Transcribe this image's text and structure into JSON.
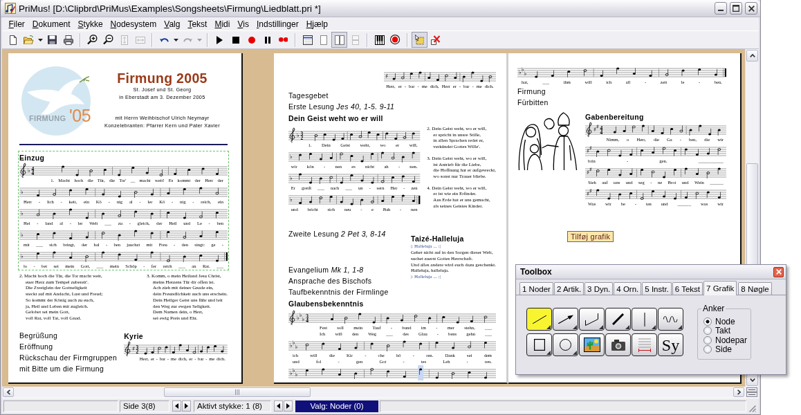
{
  "window": {
    "title": "PriMus! [D:\\Clipbrd\\PriMus\\Examples\\Songsheets\\Firmung\\Liedblatt.pri *]"
  },
  "menu": [
    "Filer",
    "Dokument",
    "Stykke",
    "Nodesystem",
    "Valg",
    "Tekst",
    "Midi",
    "Vis",
    "Indstillinger",
    "Hjælp"
  ],
  "toolbar": [
    {
      "buttons": [
        {
          "kind": "new",
          "disabled": false,
          "selected": false
        },
        {
          "kind": "open",
          "disabled": false,
          "selected": false
        },
        {
          "kind": "dropdown",
          "disabled": false,
          "selected": false
        },
        {
          "kind": "save",
          "disabled": false,
          "selected": false
        },
        {
          "kind": "print",
          "disabled": false,
          "selected": false
        }
      ]
    },
    {
      "buttons": [
        {
          "kind": "zoom-in",
          "disabled": false,
          "selected": false
        },
        {
          "kind": "zoom-out",
          "disabled": false,
          "selected": false
        },
        {
          "kind": "fit-height",
          "disabled": true,
          "selected": false
        },
        {
          "kind": "fit-width",
          "disabled": true,
          "selected": false
        }
      ]
    },
    {
      "buttons": [
        {
          "kind": "undo",
          "disabled": false,
          "selected": false
        },
        {
          "kind": "dropdown",
          "disabled": false,
          "selected": false
        },
        {
          "kind": "redo",
          "disabled": true,
          "selected": false
        },
        {
          "kind": "dropdown",
          "disabled": true,
          "selected": false
        }
      ]
    },
    {
      "buttons": [
        {
          "kind": "play",
          "disabled": false,
          "selected": false
        },
        {
          "kind": "stop",
          "disabled": false,
          "selected": false
        },
        {
          "kind": "record",
          "disabled": false,
          "selected": false
        },
        {
          "kind": "pause",
          "disabled": false,
          "selected": false
        },
        {
          "kind": "record-all",
          "disabled": false,
          "selected": false
        }
      ]
    },
    {
      "buttons": [
        {
          "kind": "page-setup",
          "disabled": false,
          "selected": false
        },
        {
          "kind": "single-page",
          "disabled": false,
          "selected": false
        },
        {
          "kind": "two-pages",
          "disabled": false,
          "selected": true
        },
        {
          "kind": "stacked-pages",
          "disabled": true,
          "selected": false
        }
      ]
    },
    {
      "buttons": [
        {
          "kind": "keyboard",
          "disabled": false,
          "selected": false
        },
        {
          "kind": "target",
          "disabled": false,
          "selected": false
        }
      ]
    },
    {
      "buttons": [
        {
          "kind": "select",
          "disabled": false,
          "selected": true
        },
        {
          "kind": "delete",
          "disabled": false,
          "selected": false
        }
      ]
    }
  ],
  "pages": [
    {
      "blocks": [
        {
          "kind": "header",
          "logo": {
            "word": "FIRMUNG",
            "year": "'05"
          },
          "title": "Firmung 2005",
          "subtitle": [
            "St. Josef und St. Georg",
            "in Eberstadt am 3. Dezember 2005"
          ],
          "celebrants": [
            "mit Herrn Weihbischof Ulrich Neymayr",
            "Konzelebranten: Pfarrer Kern und Pater Xavier"
          ]
        },
        {
          "kind": "rule"
        },
        {
          "kind": "song",
          "selected": true,
          "heading": "Einzug",
          "staves": [
            {
              "clef": true,
              "key": "♭",
              "time": [
                "4",
                "4"
              ],
              "end": false,
              "highlight": false,
              "lyrics": [
                "1. Macht hoch die Tür, die Tor' __ macht weit! Es kommt der Herr der"
              ]
            },
            {
              "clef": false,
              "key": "♭",
              "end": false,
              "highlight": false,
              "lyrics": [
                "Herr - lich - keit, ein Kö - nig al - ler Kö - nig - reich, ein"
              ]
            },
            {
              "clef": false,
              "key": "♭",
              "end": false,
              "highlight": false,
              "lyrics": [
                "Hei - land al - ler Welt ___ zu - gleich, der Heil und Le - ben"
              ]
            },
            {
              "clef": false,
              "key": "♭",
              "end": false,
              "highlight": false,
              "lyrics": [
                "mit ___ sich bringt, der hal - ben jauchzt mit Freu - den singt: ge -"
              ]
            },
            {
              "clef": false,
              "key": "♭",
              "end": true,
              "highlight": false,
              "lyrics": [
                "lo - bet sei mein Gott, ___ mein Schöp - fer reich ___ an Rat. ___"
              ]
            }
          ]
        },
        {
          "kind": "columns",
          "columns": [
            [
              {
                "kind": "verse",
                "lines": [
                  "2. Macht hoch die Tür, die Tor macht weit,",
                  "euer Herz zum Tempel zubereit'.",
                  "Die Zweiglein der Gottseligkeit",
                  "steckt auf mit Andacht, Lust und Freud;",
                  "So kommt der König auch zu euch,",
                  "ja, Heil und Leben mit zugleich.",
                  "Gelobet sei mein Gott,",
                  "voll Rat, voll Tat, voll Gnad."
                ]
              }
            ],
            [
              {
                "kind": "verse",
                "lines": [
                  "3. Komm, o mein Heiland Jesu Christ,",
                  "meins Herzens Tür dir offen ist.",
                  "Ach zieh mit deiner Gnade ein,",
                  "dein Freundlichkeit auch uns erschein.",
                  "Dein Heilger Geist uns führ und leit",
                  "den Weg zur ewgen Seligkeit.",
                  "Dem Namen dein, o Herr,",
                  "sei ewig Preis und Ehr."
                ]
              }
            ]
          ]
        },
        {
          "kind": "columns",
          "columns": [
            [
              {
                "kind": "text",
                "text": "Begrüßung"
              },
              {
                "kind": "text",
                "text": "Eröffnung"
              },
              {
                "kind": "text",
                "text": "Rückschau der Firmgruppen\nmit Bitte um die Firmung"
              }
            ],
            [
              {
                "kind": "song",
                "selected": false,
                "heading": "Kyrie",
                "staves": [
                  {
                    "clef": true,
                    "key": "♯",
                    "time": [
                      "3",
                      "2"
                    ],
                    "end": false,
                    "highlight": false,
                    "lyrics": [
                      "Herr, er - bar - me dich, er - bar - me dich."
                    ]
                  }
                ]
              }
            ]
          ]
        }
      ]
    },
    {
      "blocks": [
        {
          "kind": "song",
          "selected": false,
          "staves": [
            {
              "clef": false,
              "key": "♯",
              "end": false,
              "highlight": false,
              "lyrics": [
                "Herr, er - bar - me dich, Herr er - bar - me dich."
              ]
            }
          ]
        },
        {
          "kind": "text",
          "text": "Tagesgebet"
        },
        {
          "kind": "text",
          "text": "Erste Lesung *Jes 40, 1-5. 9-11*"
        },
        {
          "kind": "heading",
          "text": "Dein Geist weht wo er will"
        },
        {
          "kind": "columns",
          "columns": [
            [
              {
                "kind": "song",
                "selected": false,
                "staves": [
                  {
                    "clef": true,
                    "key": "♭",
                    "time": [
                      "3",
                      "2"
                    ],
                    "end": false,
                    "highlight": false,
                    "lyrics": [
                      "1. Dein Geist weht, wo er will,"
                    ]
                  },
                  {
                    "clef": false,
                    "key": "♭",
                    "end": false,
                    "highlight": false,
                    "lyrics": [
                      "wir kön - nen es nicht ah - nen."
                    ]
                  },
                  {
                    "clef": false,
                    "key": "♭",
                    "end": false,
                    "highlight": false,
                    "lyrics": [
                      "Er greift ___ nach ___ un - sern Her - zen"
                    ]
                  },
                  {
                    "clef": false,
                    "key": "♭",
                    "end": true,
                    "highlight": false,
                    "lyrics": [
                      "und bricht sich neu - e Bah - nen"
                    ]
                  }
                ]
              }
            ],
            [
              {
                "kind": "verse",
                "lines": [
                  "2. Dein Geist weht, wo er will,",
                  "er spricht in unsre Stille,",
                  "in allen Sprachen redet er,",
                  "verkündet Gottes Wille'."
                ]
              },
              {
                "kind": "verse",
                "lines": [
                  "3. Dein Geist weht, wo er will,",
                  "ist Antrieb für die Liebe,",
                  "die Hoffnung hat er aufgeweckt,",
                  "wo sonst nur Trauer bliebe."
                ]
              },
              {
                "kind": "verse",
                "lines": [
                  "4. Dein Geist weht, wo er will,",
                  "er ist wie ein Erfinder.",
                  "Aus Erde hat er uns gemacht,",
                  "als seines Geistes Kinder."
                ]
              }
            ]
          ]
        },
        {
          "kind": "columns",
          "columns": [
            [
              {
                "kind": "text",
                "text": "Zweite Lesung *2 Pet 3, 8-14*"
              },
              {
                "kind": "group",
                "items": [
                  {
                    "kind": "text",
                    "text": "Evangelium *Mk 1, 1-8*"
                  },
                  {
                    "kind": "text",
                    "text": "Ansprache des Bischofs"
                  },
                  {
                    "kind": "text",
                    "text": "Taufbekenntnis der Firmlinge"
                  }
                ]
              }
            ],
            [
              {
                "kind": "heading",
                "text": "Taizé-Halleluja"
              },
              {
                "kind": "lines",
                "lines": [
                  {
                    "kind": "refrain",
                    "text": "|: Halleluja ... :|"
                  },
                  {
                    "kind": "verse",
                    "text": "Gehet nicht auf in den Sorgen dieser Welt,"
                  },
                  {
                    "kind": "verse",
                    "text": "suchet zuerst Gottes Herrschaft."
                  },
                  {
                    "kind": "verse",
                    "text": "Und alles andere wird euch dazu geschenkt."
                  },
                  {
                    "kind": "verse",
                    "text": "Halleluja, halleluja."
                  },
                  {
                    "kind": "refrain",
                    "text": "|: Halleluja ... :|"
                  }
                ]
              }
            ]
          ]
        },
        {
          "kind": "heading",
          "text": "Glaubensbekenntnis"
        },
        {
          "kind": "song",
          "selected": false,
          "staves": [
            {
              "clef": true,
              "key": "♭♭♭",
              "time": [
                "3",
                "4"
              ],
              "end": false,
              "highlight": false,
              "lyrics": [
                "Fest soll mein Tauf - bund im - mer stehn, ___",
                "Ich will den Weg ___ des Glau - bens gehn ___"
              ]
            },
            {
              "clef": false,
              "key": "♭♭♭",
              "end": false,
              "highlight": false,
              "lyrics": [
                "ich will die Kir - che hö - ren. Dank sei dem",
                "und fol - gen Got - tes Leh - ren."
              ]
            },
            {
              "clef": false,
              "key": "♭♭♭",
              "end": false,
              "highlight": true
            }
          ]
        }
      ]
    },
    {
      "blocks": [
        {
          "kind": "song",
          "selected": false,
          "staves": [
            {
              "clef": false,
              "key": "♭♭♭",
              "end": true,
              "highlight": false,
              "lyrics": [
                "hat, ___ ihm will ich all - zeit le - ben."
              ]
            }
          ]
        },
        {
          "kind": "text",
          "text": "Firmung"
        },
        {
          "kind": "text",
          "text": "Fürbitten"
        },
        {
          "kind": "columns",
          "columns": [
            [
              {
                "kind": "clipart"
              }
            ],
            [
              {
                "kind": "song",
                "selected": false,
                "heading": "Gabenbereitung",
                "staves": [
                  {
                    "clef": true,
                    "key": "♯♯",
                    "time": [
                      "4",
                      "4"
                    ],
                    "end": false,
                    "highlight": false,
                    "lyrics": [
                      "Nimm, o Herr, die Ga - ben, die wir"
                    ]
                  },
                  {
                    "clef": false,
                    "key": "♯♯",
                    "end": false,
                    "highlight": false,
                    "lyrics": [
                      "brin - gen. ___________"
                    ]
                  },
                  {
                    "clef": false,
                    "key": "♯♯",
                    "end": false,
                    "highlight": false,
                    "lyrics": [
                      "Sieh auf uns und seg - ne Brot und Wein ______"
                    ]
                  },
                  {
                    "clef": false,
                    "key": "♯♯",
                    "end": false,
                    "highlight": false,
                    "lyrics": [
                      "Was wir be - ten und ______ was wir"
                    ]
                  }
                ]
              }
            ]
          ]
        },
        {
          "kind": "button",
          "label": "Tilføj grafik"
        }
      ]
    }
  ],
  "status_bar": {
    "page": "Side 3(8)",
    "piece": "Aktivt stykke: 1 (8)",
    "selection": "Valg: Noder (0)"
  },
  "toolbox": {
    "title": "Toolbox",
    "tabs": [
      {
        "label": "1 Noder",
        "selected": false
      },
      {
        "label": "2 Artik.",
        "selected": false
      },
      {
        "label": "3 Dyn.",
        "selected": false
      },
      {
        "label": "4 Orn.",
        "selected": false
      },
      {
        "label": "5 Instr.",
        "selected": false
      },
      {
        "label": "6 Tekst",
        "selected": false
      },
      {
        "label": "7 Grafik",
        "selected": true
      },
      {
        "label": "8 Nøgle",
        "selected": false
      }
    ],
    "tools": [
      {
        "kind": "line",
        "selected": true,
        "menu": true
      },
      {
        "kind": "arrow",
        "selected": false,
        "menu": true
      },
      {
        "kind": "angled-line",
        "selected": false,
        "menu": true
      },
      {
        "kind": "thick-line",
        "selected": false,
        "menu": true
      },
      {
        "kind": "vertical-line",
        "selected": false,
        "menu": true
      },
      {
        "kind": "wavy-line",
        "selected": false,
        "menu": true
      },
      {
        "kind": "rectangle",
        "selected": false,
        "menu": true
      },
      {
        "kind": "circle",
        "selected": false,
        "menu": true
      },
      {
        "kind": "picture",
        "selected": false,
        "menu": false
      },
      {
        "kind": "camera",
        "selected": false,
        "menu": false
      },
      {
        "kind": "staff-lines",
        "selected": false,
        "menu": false
      },
      {
        "kind": "symbol",
        "label": "Sy",
        "selected": false,
        "menu": false
      }
    ],
    "anchor": {
      "legend": "Anker",
      "options": [
        {
          "label": "Node",
          "selected": true
        },
        {
          "label": "Takt",
          "selected": false
        },
        {
          "label": "Nodepar",
          "selected": false
        },
        {
          "label": "Side",
          "selected": false
        }
      ]
    }
  }
}
